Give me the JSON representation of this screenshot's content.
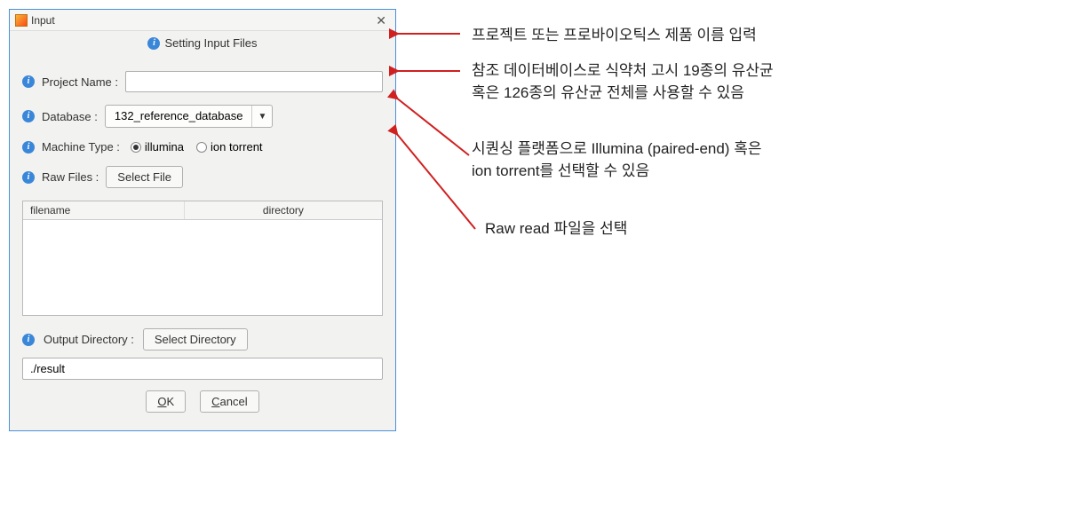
{
  "window": {
    "title": "Input",
    "subtitle": "Setting Input Files"
  },
  "form": {
    "project_name_label": "Project Name :",
    "project_name_value": "",
    "database_label": "Database :",
    "database_value": "132_reference_database",
    "machine_type_label": "Machine Type :",
    "machine_options": {
      "illumina": "illumina",
      "ion_torrent": "ion torrent"
    },
    "raw_files_label": "Raw Files :",
    "select_file_btn": "Select File",
    "table_headers": {
      "filename": "filename",
      "directory": "directory"
    },
    "output_dir_label": "Output Directory :",
    "select_dir_btn": "Select Directory",
    "output_path": "./result",
    "ok_btn": "OK",
    "cancel_btn": "Cancel"
  },
  "annotations": {
    "a1": "프로젝트 또는 프로바이오틱스 제품 이름 입력",
    "a2_line1": "참조 데이터베이스로 식약처 고시 19종의 유산균",
    "a2_line2": "혹은 126종의 유산균 전체를 사용할 수 있음",
    "a3_line1": "시퀀싱 플랫폼으로 Illumina (paired-end) 혹은",
    "a3_line2": "ion torrent를 선택할 수 있음",
    "a4": "Raw read 파일을 선택"
  }
}
